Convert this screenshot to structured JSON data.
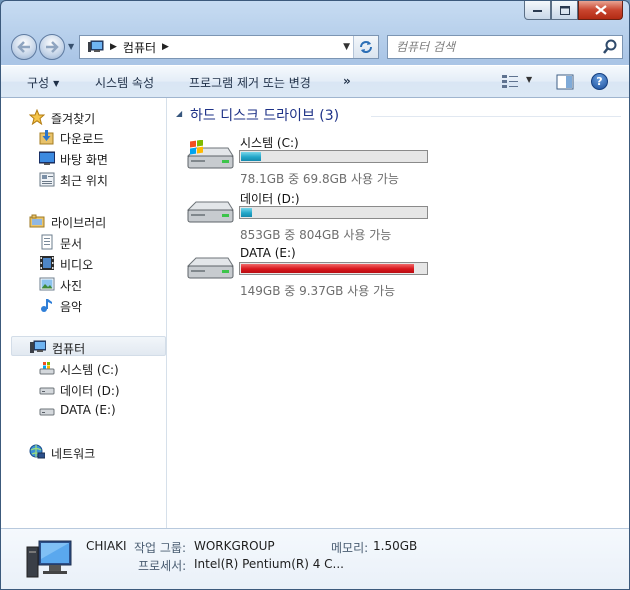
{
  "address": {
    "breadcrumb": [
      "컴퓨터"
    ]
  },
  "search": {
    "placeholder": "컴퓨터 검색"
  },
  "toolbar": {
    "organize": "구성",
    "system_properties": "시스템 속성",
    "uninstall": "프로그램 제거 또는 변경",
    "more": "»"
  },
  "sidebar": {
    "favorites": {
      "label": "즐겨찾기",
      "items": [
        {
          "label": "다운로드",
          "icon": "download-folder-icon"
        },
        {
          "label": "바탕 화면",
          "icon": "desktop-icon"
        },
        {
          "label": "최근 위치",
          "icon": "recent-places-icon"
        }
      ]
    },
    "libraries": {
      "label": "라이브러리",
      "items": [
        {
          "label": "문서",
          "icon": "documents-icon"
        },
        {
          "label": "비디오",
          "icon": "video-icon"
        },
        {
          "label": "사진",
          "icon": "pictures-icon"
        },
        {
          "label": "음악",
          "icon": "music-icon"
        }
      ]
    },
    "computer": {
      "label": "컴퓨터",
      "items": [
        {
          "label": "시스템 (C:)",
          "icon": "windows-drive-icon"
        },
        {
          "label": "데이터 (D:)",
          "icon": "drive-icon"
        },
        {
          "label": "DATA (E:)",
          "icon": "drive-icon"
        }
      ]
    },
    "network": {
      "label": "네트워크"
    }
  },
  "main": {
    "section_title": "하드 디스크 드라이브 (3)",
    "drives": [
      {
        "name": "시스템 (C:)",
        "info": "78.1GB 중 69.8GB 사용 가능",
        "used_fraction": 0.106,
        "bar_color": "#23a7c9"
      },
      {
        "name": "데이터 (D:)",
        "info": "853GB 중 804GB 사용 가능",
        "used_fraction": 0.057,
        "bar_color": "#23a7c9"
      },
      {
        "name": "DATA (E:)",
        "info": "149GB 중 9.37GB 사용 가능",
        "used_fraction": 0.937,
        "bar_color": "#d8161c"
      }
    ]
  },
  "details": {
    "computer_name": "CHIAKI",
    "workgroup_label": "작업 그룹:",
    "workgroup_value": "WORKGROUP",
    "memory_label": "메모리:",
    "memory_value": "1.50GB",
    "processor_label": "프로세서:",
    "processor_value": "Intel(R) Pentium(R) 4 C..."
  }
}
